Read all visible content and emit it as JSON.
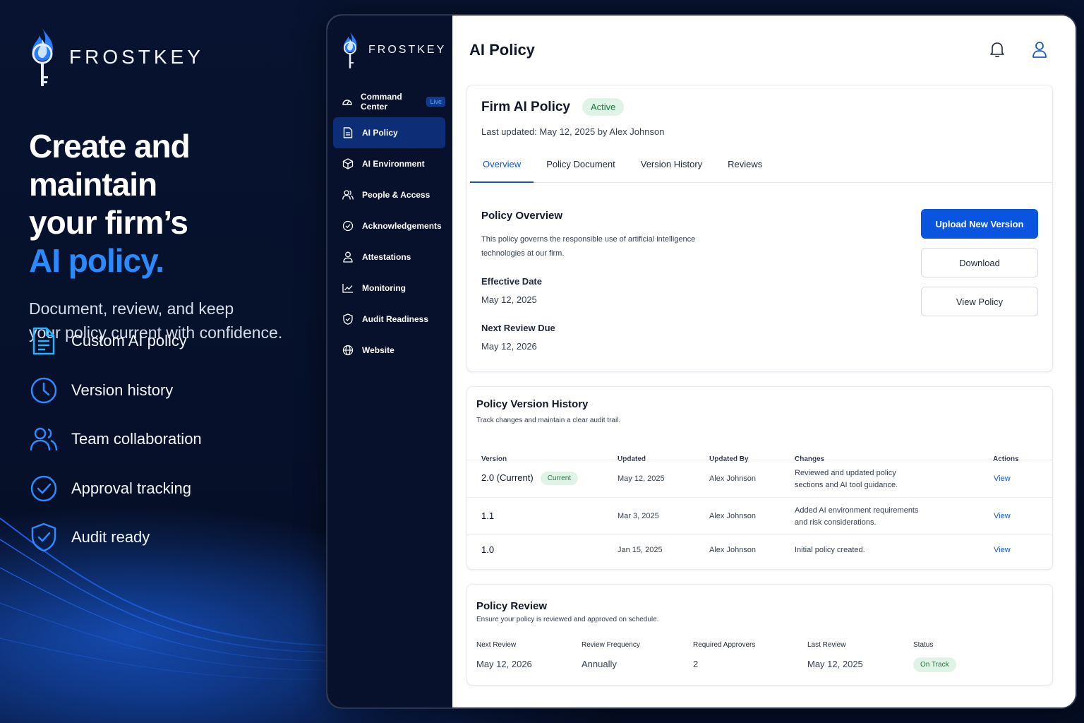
{
  "brand": {
    "name": "FROSTKEY"
  },
  "hero": {
    "line1": "Create and maintain",
    "line2": "your firm’s",
    "accent": "AI policy.",
    "subtitle_line1": "Document, review, and keep",
    "subtitle_line2": "your policy current with confidence."
  },
  "features": [
    {
      "label": "Custom AI policy",
      "icon": "document-icon"
    },
    {
      "label": "Version history",
      "icon": "clock-icon"
    },
    {
      "label": "Team collaboration",
      "icon": "users-icon"
    },
    {
      "label": "Approval tracking",
      "icon": "check-circle-icon"
    },
    {
      "label": "Audit ready",
      "icon": "shield-check-icon"
    }
  ],
  "sidebar": {
    "brand": "FROSTKEY",
    "live": "Live",
    "items": [
      {
        "label": "Command Center",
        "icon": "gauge-icon"
      },
      {
        "label": "AI Policy",
        "icon": "document-icon",
        "active": true
      },
      {
        "label": "AI Environment",
        "icon": "cube-icon"
      },
      {
        "label": "People & Access",
        "icon": "users-icon"
      },
      {
        "label": "Acknowledgements",
        "icon": "check-circle-icon"
      },
      {
        "label": "Attestations",
        "icon": "user-icon"
      },
      {
        "label": "Monitoring",
        "icon": "chart-icon"
      },
      {
        "label": "Audit Readiness",
        "icon": "shield-check-icon"
      },
      {
        "label": "Website",
        "icon": "globe-icon"
      }
    ]
  },
  "header": {
    "title": "AI Policy"
  },
  "policy": {
    "name": "Firm AI Policy",
    "status": "Active",
    "updated": "Last updated: May 12, 2025 by Alex Johnson",
    "tabs": [
      "Overview",
      "Policy Document",
      "Version History",
      "Reviews"
    ],
    "overview_title": "Policy Overview",
    "overview_desc": "This policy governs the responsible use of artificial intelligence technologies at our firm.",
    "effective_label": "Effective Date",
    "effective_value": "May 12, 2025",
    "next_review_label": "Next Review Due",
    "next_review_value": "May 12, 2026",
    "buttons": {
      "upload": "Upload New Version",
      "download": "Download",
      "view": "View Policy"
    }
  },
  "history": {
    "title": "Policy Version History",
    "subtitle": "Track changes and maintain a clear audit trail.",
    "columns": [
      "Version",
      "Updated",
      "Updated By",
      "Changes",
      "Actions"
    ],
    "current_badge": "Current",
    "rows": [
      {
        "version": "2.0 (Current)",
        "updated": "May 12, 2025",
        "by": "Alex Johnson",
        "changes1": "Reviewed and updated policy",
        "changes2": "sections and AI tool guidance.",
        "action": "View"
      },
      {
        "version": "1.1",
        "updated": "Mar 3, 2025",
        "by": "Alex Johnson",
        "changes1": "Added AI environment requirements",
        "changes2": "and risk considerations.",
        "action": "View"
      },
      {
        "version": "1.0",
        "updated": "Jan 15, 2025",
        "by": "Alex Johnson",
        "changes1": "Initial policy created.",
        "changes2": "",
        "action": "View"
      }
    ]
  },
  "review": {
    "title": "Policy Review",
    "subtitle": "Ensure your policy is reviewed and approved on schedule.",
    "next_review_label": "Next Review",
    "next_review_value": "May 12, 2026",
    "frequency_label": "Review Frequency",
    "frequency_value": "Annually",
    "approvers_label": "Required Approvers",
    "approvers_value": "2",
    "last_review_label": "Last Review",
    "last_review_value": "May 12, 2025",
    "status_label": "Status",
    "status_value": "On Track"
  },
  "colors": {
    "accent": "#2a8bff",
    "primary_button": "#0a55e0",
    "sidebar": "#07112b",
    "success": "#1b7a3e"
  }
}
